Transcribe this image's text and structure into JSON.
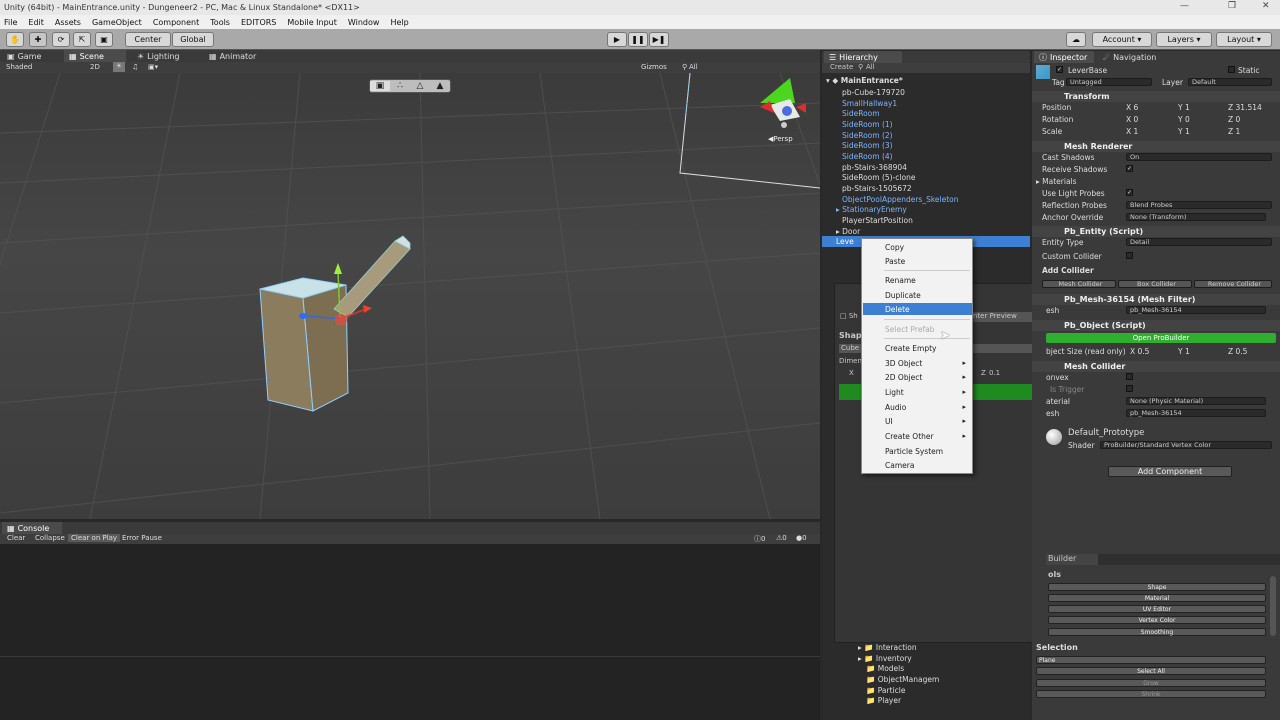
{
  "window": {
    "title": "Unity (64bit) - MainEntrance.unity - Dungeneer2 - PC, Mac & Linux Standalone* <DX11>"
  },
  "menu": [
    "File",
    "Edit",
    "Assets",
    "GameObject",
    "Component",
    "Tools",
    "EDITORS",
    "Mobile Input",
    "Window",
    "Help"
  ],
  "toolbar": {
    "center": "Center",
    "global": "Global",
    "account": "Account",
    "layers": "Layers",
    "layout": "Layout"
  },
  "tabs": {
    "game": "Game",
    "scene": "Scene",
    "lighting": "Lighting",
    "animator": "Animator",
    "console": "Console",
    "hierarchy": "Hierarchy",
    "inspector": "Inspector",
    "navigation": "Navigation"
  },
  "scene": {
    "shaded": "Shaded",
    "mode2d": "2D",
    "gizmos": "Gizmos",
    "search": "All",
    "persp": "Persp"
  },
  "console": {
    "clear": "Clear",
    "collapse": "Collapse",
    "clear_on_play": "Clear on Play",
    "error_pause": "Error Pause",
    "count0": "0",
    "count1": "0",
    "count2": "0"
  },
  "hierarchy": {
    "create": "Create",
    "search": "All",
    "scene": "MainEntrance*",
    "items": [
      "pb-Cube-179720",
      "SmallHallway1",
      "SideRoom",
      "SideRoom (1)",
      "SideRoom (2)",
      "SideRoom (3)",
      "SideRoom (4)",
      "pb-Stairs-368904",
      "SideRoom (5)-clone",
      "pb-Stairs-1505672",
      "ObjectPoolAppenders_Skeleton",
      "StationaryEnemy",
      "PlayerStartPosition",
      "Door",
      "Leve"
    ],
    "folders": [
      "Interaction",
      "Inventory",
      "Models",
      "ObjectManagem",
      "Particle",
      "Player"
    ]
  },
  "context_menu": {
    "items": [
      "Copy",
      "Paste",
      "Rename",
      "Duplicate",
      "Delete",
      "Select Prefab",
      "Create Empty",
      "3D Object",
      "2D Object",
      "Light",
      "Audio",
      "UI",
      "Create Other",
      "Particle System",
      "Camera"
    ]
  },
  "inspector": {
    "name": "LeverBase",
    "static": "Static",
    "tag_label": "Tag",
    "tag": "Untagged",
    "layer_label": "Layer",
    "layer": "Default",
    "transform": {
      "title": "Transform",
      "position": "Position",
      "rotation": "Rotation",
      "scale": "Scale",
      "px": "6",
      "py": "1",
      "pz": "31.514",
      "rx": "0",
      "ry": "0",
      "rz": "0",
      "sx": "1",
      "sy": "1",
      "sz": "1"
    },
    "mesh_renderer": {
      "title": "Mesh Renderer",
      "cast_shadows": "Cast Shadows",
      "cast_value": "On",
      "receive_shadows": "Receive Shadows",
      "materials": "Materials",
      "use_light_probes": "Use Light Probes",
      "reflection_probes": "Reflection Probes",
      "reflection_value": "Blend Probes",
      "anchor_override": "Anchor Override",
      "anchor_value": "None (Transform)"
    },
    "pb_entity": {
      "title": "Pb_Entity (Script)",
      "entity_type": "Entity Type",
      "entity_value": "Detail",
      "custom_collider": "Custom Collider",
      "add_collider": "Add Collider",
      "mesh_collider_btn": "Mesh Collider",
      "box_collider_btn": "Box Collider",
      "remove_collider_btn": "Remove Collider"
    },
    "mesh_filter": {
      "title": "Pb_Mesh-36154 (Mesh Filter)",
      "mesh_label": "esh",
      "mesh_value": "pb_Mesh-36154"
    },
    "pb_object": {
      "title": "Pb_Object (Script)",
      "open_button": "Open ProBuilder",
      "size_label": "bject Size (read only)",
      "x": "0.5",
      "y": "1",
      "z": "0.5"
    },
    "mesh_collider": {
      "title": "Mesh Collider",
      "convex": "onvex",
      "is_trigger": "Is Trigger",
      "material": "aterial",
      "material_value": "None (Physic Material)",
      "mesh": "esh",
      "mesh_value": "pb_Mesh-36154"
    },
    "material": {
      "name": "Default_Prototype",
      "shader_label": "Shader",
      "shader": "ProBuilder/Standard Vertex Color"
    },
    "add_component": "Add Component"
  },
  "probuilder": {
    "tab": "Builder",
    "tools": "ols",
    "buttons": [
      "Shape",
      "Material",
      "UV Editor",
      "Vertex Color",
      "Smoothing"
    ],
    "selection": "Selection",
    "plane": "Plane",
    "select_all": "Select All",
    "grow": "Grow",
    "shrink": "Shrink"
  },
  "shape_panel": {
    "shape": "Shap",
    "cube": "Cube",
    "dimen": "Dimen",
    "preview": "nter Preview",
    "sh": "Sh",
    "x": "X",
    "z": "Z",
    "zval": "0.1"
  },
  "colors": {
    "selection": "#3d7fd3",
    "probuilder_green": "#2fae2f",
    "prefab_blue": "#7eb5ff"
  }
}
